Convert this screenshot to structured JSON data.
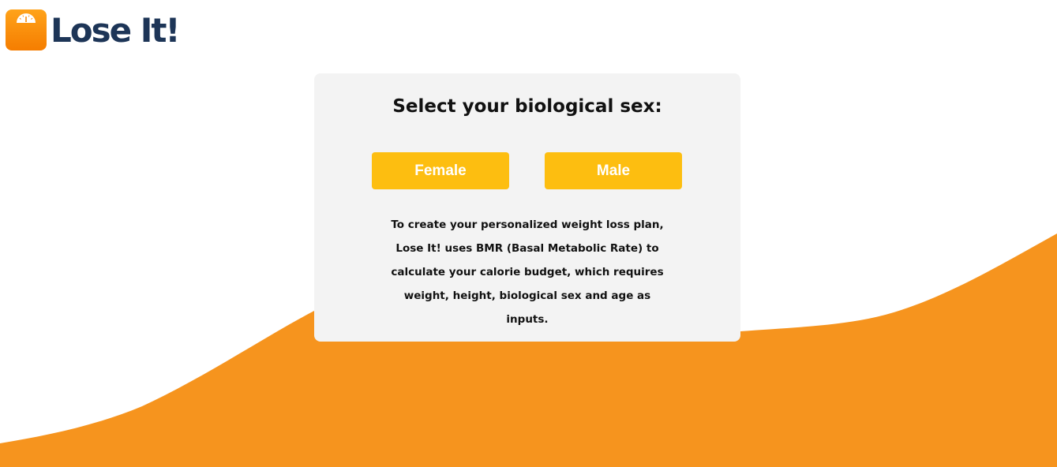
{
  "brand": {
    "name": "Lose It!",
    "icon": "scale-icon",
    "text_color": "#1d3557",
    "icon_color": "#f78a0e"
  },
  "card": {
    "title": "Select your biological sex:",
    "options": {
      "female_label": "Female",
      "male_label": "Male"
    },
    "description": "To create your personalized weight loss plan, Lose It! uses BMR (Basal Metabolic Rate) to calculate your calorie budget, which requires weight, height, biological sex and age as inputs."
  },
  "colors": {
    "accent_button": "#fdbe10",
    "wave": "#f6941e",
    "card_background": "#f3f3f3"
  }
}
